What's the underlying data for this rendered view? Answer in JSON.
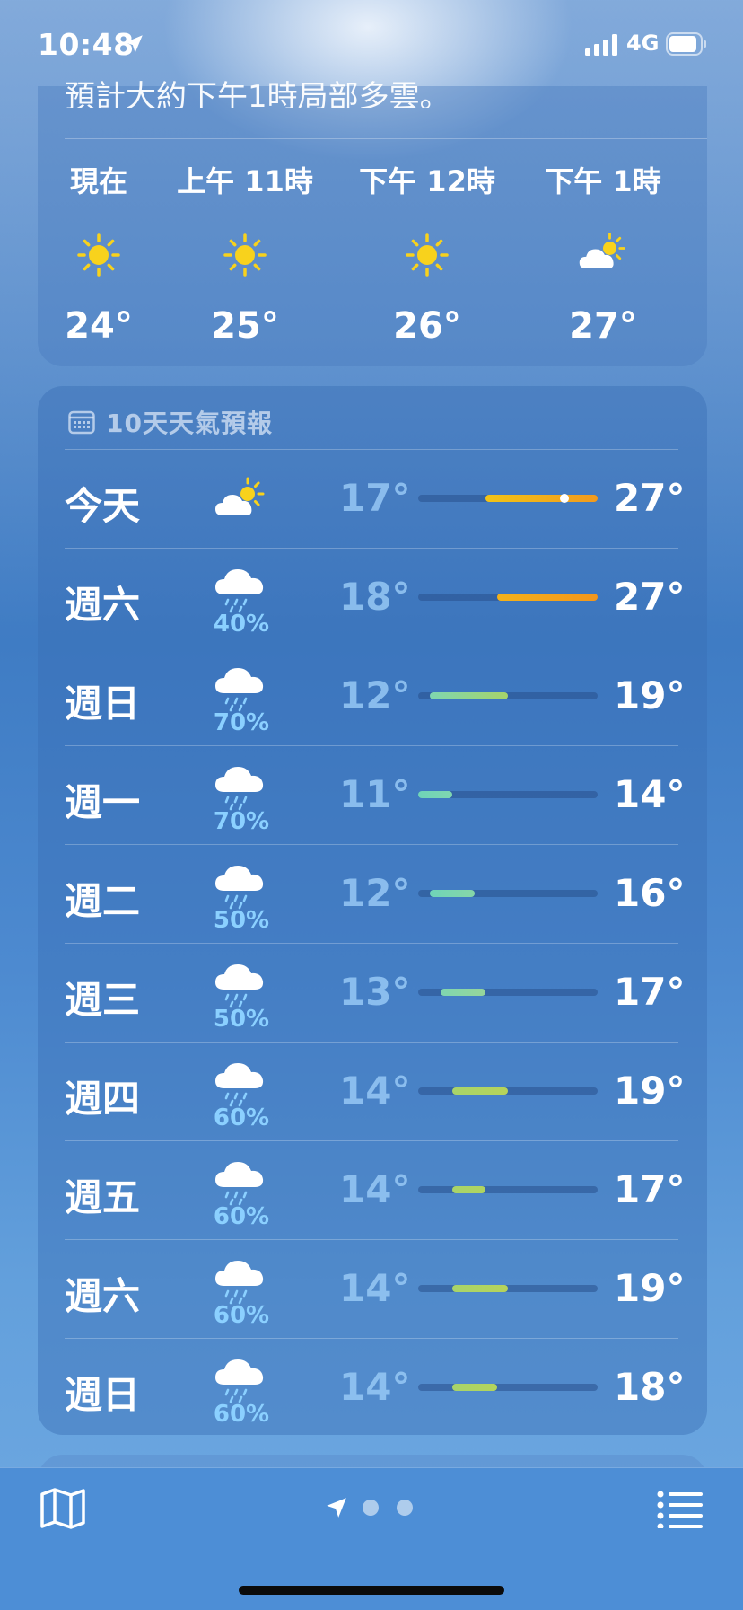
{
  "status_bar": {
    "time": "10:48",
    "network": "4G"
  },
  "hourly": {
    "summary": "預計大約下午1時局部多雲。",
    "hours": [
      {
        "label": "現在",
        "icon": "sun-icon",
        "temp": "24°"
      },
      {
        "label": "上午 11時",
        "icon": "sun-icon",
        "temp": "25°"
      },
      {
        "label": "下午 12時",
        "icon": "sun-icon",
        "temp": "26°"
      },
      {
        "label": "下午 1時",
        "icon": "partly-cloudy-icon",
        "temp": "27°"
      }
    ]
  },
  "forecast": {
    "title": "10天天氣預報",
    "range_min": 11,
    "range_max": 27,
    "days": [
      {
        "day": "今天",
        "icon": "partly-cloudy-icon",
        "precip": "",
        "low": "17°",
        "high": "27°",
        "lo": 17,
        "hi": 27,
        "current": 24,
        "colors": [
          "#f2c417",
          "#f29a1d"
        ]
      },
      {
        "day": "週六",
        "icon": "rain-icon",
        "precip": "40%",
        "low": "18°",
        "high": "27°",
        "lo": 18,
        "hi": 27,
        "colors": [
          "#f4b21a",
          "#f2961c"
        ]
      },
      {
        "day": "週日",
        "icon": "rain-icon",
        "precip": "70%",
        "low": "12°",
        "high": "19°",
        "lo": 12,
        "hi": 19,
        "colors": [
          "#7fd6b0",
          "#a6d46a"
        ]
      },
      {
        "day": "週一",
        "icon": "rain-icon",
        "precip": "70%",
        "low": "11°",
        "high": "14°",
        "lo": 11,
        "hi": 14,
        "colors": [
          "#6fd4b8",
          "#7fd6b0"
        ]
      },
      {
        "day": "週二",
        "icon": "rain-icon",
        "precip": "50%",
        "low": "12°",
        "high": "16°",
        "lo": 12,
        "hi": 16,
        "colors": [
          "#6fd4b8",
          "#86d6a8"
        ]
      },
      {
        "day": "週三",
        "icon": "rain-icon",
        "precip": "50%",
        "low": "13°",
        "high": "17°",
        "lo": 13,
        "hi": 17,
        "colors": [
          "#7fd6b0",
          "#96d59a"
        ]
      },
      {
        "day": "週四",
        "icon": "rain-icon",
        "precip": "60%",
        "low": "14°",
        "high": "19°",
        "lo": 14,
        "hi": 19,
        "colors": [
          "#a8d46a",
          "#b6d35a"
        ]
      },
      {
        "day": "週五",
        "icon": "rain-icon",
        "precip": "60%",
        "low": "14°",
        "high": "17°",
        "lo": 14,
        "hi": 17,
        "colors": [
          "#a8d46a",
          "#b0d460"
        ]
      },
      {
        "day": "週六",
        "icon": "rain-icon",
        "precip": "60%",
        "low": "14°",
        "high": "19°",
        "lo": 14,
        "hi": 19,
        "colors": [
          "#a8d46a",
          "#b6d35a"
        ]
      },
      {
        "day": "週日",
        "icon": "rain-icon",
        "precip": "60%",
        "low": "14°",
        "high": "18°",
        "lo": 14,
        "hi": 18,
        "colors": [
          "#a8d46a",
          "#b3d45c"
        ]
      }
    ]
  },
  "colors": {
    "sun": "#f8d21c",
    "precip_text": "#8bd0ff"
  }
}
